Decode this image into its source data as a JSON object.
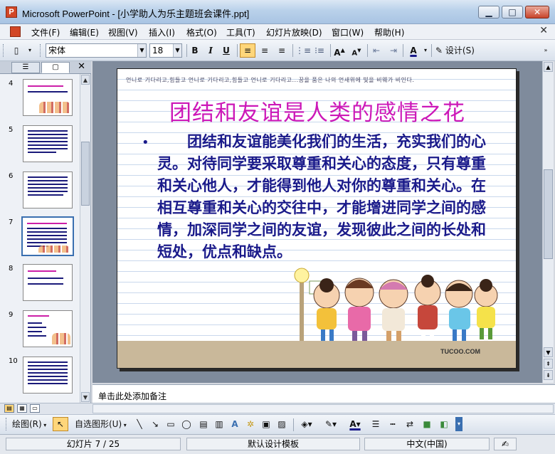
{
  "window": {
    "title": "Microsoft PowerPoint - [小学助人为乐主题班会课件.ppt]",
    "minimize_label": "▁",
    "maximize_label": "□",
    "close_label": "✕"
  },
  "menu": {
    "items": [
      "文件(F)",
      "编辑(E)",
      "视图(V)",
      "插入(I)",
      "格式(O)",
      "工具(T)",
      "幻灯片放映(D)",
      "窗口(W)",
      "帮助(H)"
    ],
    "close_label": "✕"
  },
  "toolbar": {
    "font_name": "宋体",
    "font_size": "18",
    "bold": "B",
    "italic": "I",
    "underline": "U",
    "design_label": "设计(S)",
    "font_color": "#1a1a8a"
  },
  "panel": {
    "tab_outline_icon": "outline-icon",
    "tab_slides_icon": "slides-icon",
    "close_label": "✕",
    "thumbnails": [
      {
        "number": "4"
      },
      {
        "number": "5"
      },
      {
        "number": "6"
      },
      {
        "number": "7"
      },
      {
        "number": "8"
      },
      {
        "number": "9"
      },
      {
        "number": "10"
      }
    ],
    "selected_thumbnail": "7"
  },
  "slide": {
    "handwriting": "언니로 기다리고,힘들고 언니로 기다리고,힘들고 언니로 기다리고...꿈을 품은 나의 언새위에 빛을 비웨가 비인다.",
    "title": "团结和友谊是人类的感情之花",
    "title_color": "#cc18b8",
    "bullet": "•",
    "body": "团结和友谊能美化我们的生活，充实我们的心灵。对待同学要采取尊重和关心的态度，只有尊重和关心他人，才能得到他人对你的尊重和关心。在相互尊重和关心的交往中，才能增进同学之间的感情，加深同学之间的友谊，发现彼此之间的长处和短处，优点和缺点。",
    "body_color": "#1a1a8a",
    "watermark": "TUCOO.COM"
  },
  "notes": {
    "placeholder": "单击此处添加备注"
  },
  "drawing_toolbar": {
    "draw_label": "绘图(R)",
    "autoshapes_label": "自选图形(U)"
  },
  "status": {
    "slide_counter": "幻灯片 7 / 25",
    "template": "默认设计模板",
    "language": "中文(中国)"
  }
}
